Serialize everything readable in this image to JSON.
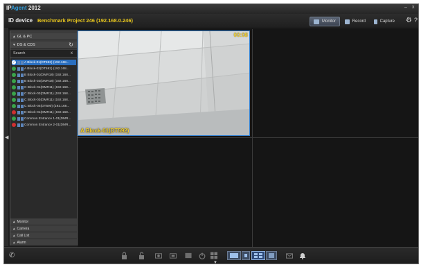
{
  "titlebar": {
    "app_prefix": "IP",
    "app_brand": "Agent",
    "app_year": "2012",
    "minimize": "–",
    "close": "x"
  },
  "header": {
    "label": "ID device",
    "project": "Benchmark Project  246 (192.168.0.246)",
    "modes": [
      {
        "label": "Monitor",
        "active": true
      },
      {
        "label": "Record",
        "active": false
      },
      {
        "label": "Capture",
        "active": false
      }
    ],
    "settings_icon": "gear-icon",
    "help_label": "?"
  },
  "sidebar": {
    "groups": [
      "GL & PC",
      "DS & CDS"
    ],
    "search_label": "Search",
    "search_clear": "x",
    "devices": [
      {
        "name": "A Block-01(DT592) (192.168...",
        "status": "selected"
      },
      {
        "name": "A Block-02(DT592) (192.168...",
        "status": "ok"
      },
      {
        "name": "B Block-01(DMR18) (192.168...",
        "status": "ok"
      },
      {
        "name": "B Block-02(DMR18) (192.168...",
        "status": "ok"
      },
      {
        "name": "C Block-01(DMR11) (192.168...",
        "status": "ok"
      },
      {
        "name": "C Block-02(DMR11) (192.168...",
        "status": "ok"
      },
      {
        "name": "C Block-03(DMR11) (192.168...",
        "status": "ok"
      },
      {
        "name": "C Block-04(DT590) (192.168...",
        "status": "ok"
      },
      {
        "name": "D Block-01(DMR11) (192.168...",
        "status": "error"
      },
      {
        "name": "Common Entrance 1-01(DMR...",
        "status": "ok"
      },
      {
        "name": "Common Entrance 2-01(DMR...",
        "status": "error"
      }
    ],
    "sections": [
      "Monitor",
      "Camera",
      "Call List",
      "Alarm"
    ]
  },
  "video": {
    "timestamp": "00:08",
    "camera_label": "A Block-01(DT592)"
  },
  "colors": {
    "accent": "#2f7fd1",
    "overlay_text": "#f2d02a",
    "status_ok": "#3aa34a",
    "status_error": "#d03030"
  }
}
